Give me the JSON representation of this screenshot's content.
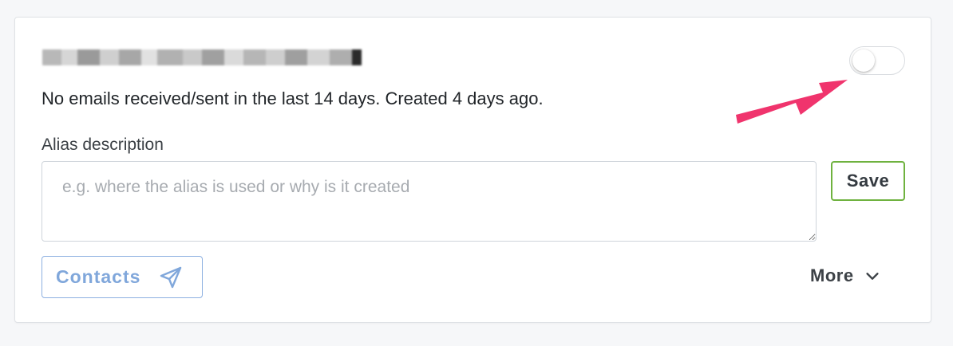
{
  "alias": {
    "email": "",
    "stats_text": "No emails received/sent in the last 14 days. Created 4 days ago.",
    "enabled": false
  },
  "description": {
    "label": "Alias description",
    "placeholder": "e.g. where the alias is used or why is it created",
    "value": ""
  },
  "actions": {
    "save_label": "Save",
    "contacts_label": "Contacts",
    "more_label": "More"
  },
  "icons": {
    "contacts": "send-icon",
    "more": "chevron-down-icon",
    "annotation": "arrow-icon"
  },
  "colors": {
    "save_border": "#6fb23f",
    "contacts_accent": "#80a7db",
    "annotation_arrow": "#f0346d"
  }
}
